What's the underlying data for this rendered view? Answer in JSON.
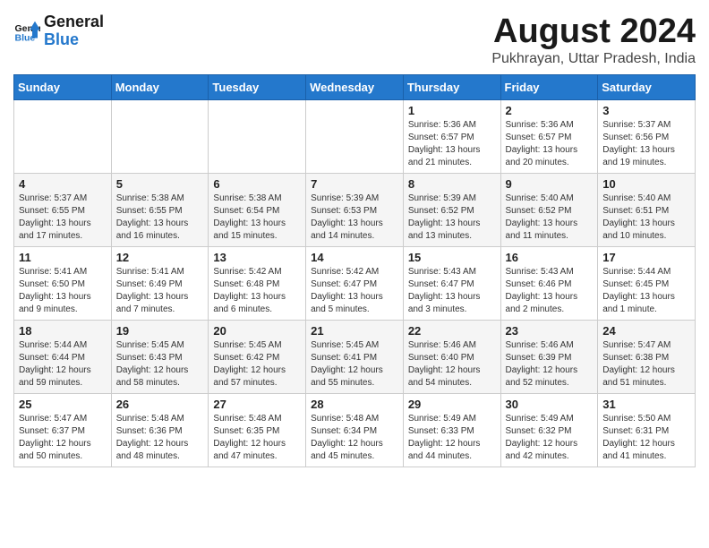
{
  "header": {
    "logo_general": "General",
    "logo_blue": "Blue",
    "month_year": "August 2024",
    "location": "Pukhrayan, Uttar Pradesh, India"
  },
  "weekdays": [
    "Sunday",
    "Monday",
    "Tuesday",
    "Wednesday",
    "Thursday",
    "Friday",
    "Saturday"
  ],
  "weeks": [
    [
      {
        "day": "",
        "sunrise": "",
        "sunset": "",
        "daylight": ""
      },
      {
        "day": "",
        "sunrise": "",
        "sunset": "",
        "daylight": ""
      },
      {
        "day": "",
        "sunrise": "",
        "sunset": "",
        "daylight": ""
      },
      {
        "day": "",
        "sunrise": "",
        "sunset": "",
        "daylight": ""
      },
      {
        "day": "1",
        "sunrise": "Sunrise: 5:36 AM",
        "sunset": "Sunset: 6:57 PM",
        "daylight": "Daylight: 13 hours and 21 minutes."
      },
      {
        "day": "2",
        "sunrise": "Sunrise: 5:36 AM",
        "sunset": "Sunset: 6:57 PM",
        "daylight": "Daylight: 13 hours and 20 minutes."
      },
      {
        "day": "3",
        "sunrise": "Sunrise: 5:37 AM",
        "sunset": "Sunset: 6:56 PM",
        "daylight": "Daylight: 13 hours and 19 minutes."
      }
    ],
    [
      {
        "day": "4",
        "sunrise": "Sunrise: 5:37 AM",
        "sunset": "Sunset: 6:55 PM",
        "daylight": "Daylight: 13 hours and 17 minutes."
      },
      {
        "day": "5",
        "sunrise": "Sunrise: 5:38 AM",
        "sunset": "Sunset: 6:55 PM",
        "daylight": "Daylight: 13 hours and 16 minutes."
      },
      {
        "day": "6",
        "sunrise": "Sunrise: 5:38 AM",
        "sunset": "Sunset: 6:54 PM",
        "daylight": "Daylight: 13 hours and 15 minutes."
      },
      {
        "day": "7",
        "sunrise": "Sunrise: 5:39 AM",
        "sunset": "Sunset: 6:53 PM",
        "daylight": "Daylight: 13 hours and 14 minutes."
      },
      {
        "day": "8",
        "sunrise": "Sunrise: 5:39 AM",
        "sunset": "Sunset: 6:52 PM",
        "daylight": "Daylight: 13 hours and 13 minutes."
      },
      {
        "day": "9",
        "sunrise": "Sunrise: 5:40 AM",
        "sunset": "Sunset: 6:52 PM",
        "daylight": "Daylight: 13 hours and 11 minutes."
      },
      {
        "day": "10",
        "sunrise": "Sunrise: 5:40 AM",
        "sunset": "Sunset: 6:51 PM",
        "daylight": "Daylight: 13 hours and 10 minutes."
      }
    ],
    [
      {
        "day": "11",
        "sunrise": "Sunrise: 5:41 AM",
        "sunset": "Sunset: 6:50 PM",
        "daylight": "Daylight: 13 hours and 9 minutes."
      },
      {
        "day": "12",
        "sunrise": "Sunrise: 5:41 AM",
        "sunset": "Sunset: 6:49 PM",
        "daylight": "Daylight: 13 hours and 7 minutes."
      },
      {
        "day": "13",
        "sunrise": "Sunrise: 5:42 AM",
        "sunset": "Sunset: 6:48 PM",
        "daylight": "Daylight: 13 hours and 6 minutes."
      },
      {
        "day": "14",
        "sunrise": "Sunrise: 5:42 AM",
        "sunset": "Sunset: 6:47 PM",
        "daylight": "Daylight: 13 hours and 5 minutes."
      },
      {
        "day": "15",
        "sunrise": "Sunrise: 5:43 AM",
        "sunset": "Sunset: 6:47 PM",
        "daylight": "Daylight: 13 hours and 3 minutes."
      },
      {
        "day": "16",
        "sunrise": "Sunrise: 5:43 AM",
        "sunset": "Sunset: 6:46 PM",
        "daylight": "Daylight: 13 hours and 2 minutes."
      },
      {
        "day": "17",
        "sunrise": "Sunrise: 5:44 AM",
        "sunset": "Sunset: 6:45 PM",
        "daylight": "Daylight: 13 hours and 1 minute."
      }
    ],
    [
      {
        "day": "18",
        "sunrise": "Sunrise: 5:44 AM",
        "sunset": "Sunset: 6:44 PM",
        "daylight": "Daylight: 12 hours and 59 minutes."
      },
      {
        "day": "19",
        "sunrise": "Sunrise: 5:45 AM",
        "sunset": "Sunset: 6:43 PM",
        "daylight": "Daylight: 12 hours and 58 minutes."
      },
      {
        "day": "20",
        "sunrise": "Sunrise: 5:45 AM",
        "sunset": "Sunset: 6:42 PM",
        "daylight": "Daylight: 12 hours and 57 minutes."
      },
      {
        "day": "21",
        "sunrise": "Sunrise: 5:45 AM",
        "sunset": "Sunset: 6:41 PM",
        "daylight": "Daylight: 12 hours and 55 minutes."
      },
      {
        "day": "22",
        "sunrise": "Sunrise: 5:46 AM",
        "sunset": "Sunset: 6:40 PM",
        "daylight": "Daylight: 12 hours and 54 minutes."
      },
      {
        "day": "23",
        "sunrise": "Sunrise: 5:46 AM",
        "sunset": "Sunset: 6:39 PM",
        "daylight": "Daylight: 12 hours and 52 minutes."
      },
      {
        "day": "24",
        "sunrise": "Sunrise: 5:47 AM",
        "sunset": "Sunset: 6:38 PM",
        "daylight": "Daylight: 12 hours and 51 minutes."
      }
    ],
    [
      {
        "day": "25",
        "sunrise": "Sunrise: 5:47 AM",
        "sunset": "Sunset: 6:37 PM",
        "daylight": "Daylight: 12 hours and 50 minutes."
      },
      {
        "day": "26",
        "sunrise": "Sunrise: 5:48 AM",
        "sunset": "Sunset: 6:36 PM",
        "daylight": "Daylight: 12 hours and 48 minutes."
      },
      {
        "day": "27",
        "sunrise": "Sunrise: 5:48 AM",
        "sunset": "Sunset: 6:35 PM",
        "daylight": "Daylight: 12 hours and 47 minutes."
      },
      {
        "day": "28",
        "sunrise": "Sunrise: 5:48 AM",
        "sunset": "Sunset: 6:34 PM",
        "daylight": "Daylight: 12 hours and 45 minutes."
      },
      {
        "day": "29",
        "sunrise": "Sunrise: 5:49 AM",
        "sunset": "Sunset: 6:33 PM",
        "daylight": "Daylight: 12 hours and 44 minutes."
      },
      {
        "day": "30",
        "sunrise": "Sunrise: 5:49 AM",
        "sunset": "Sunset: 6:32 PM",
        "daylight": "Daylight: 12 hours and 42 minutes."
      },
      {
        "day": "31",
        "sunrise": "Sunrise: 5:50 AM",
        "sunset": "Sunset: 6:31 PM",
        "daylight": "Daylight: 12 hours and 41 minutes."
      }
    ]
  ]
}
